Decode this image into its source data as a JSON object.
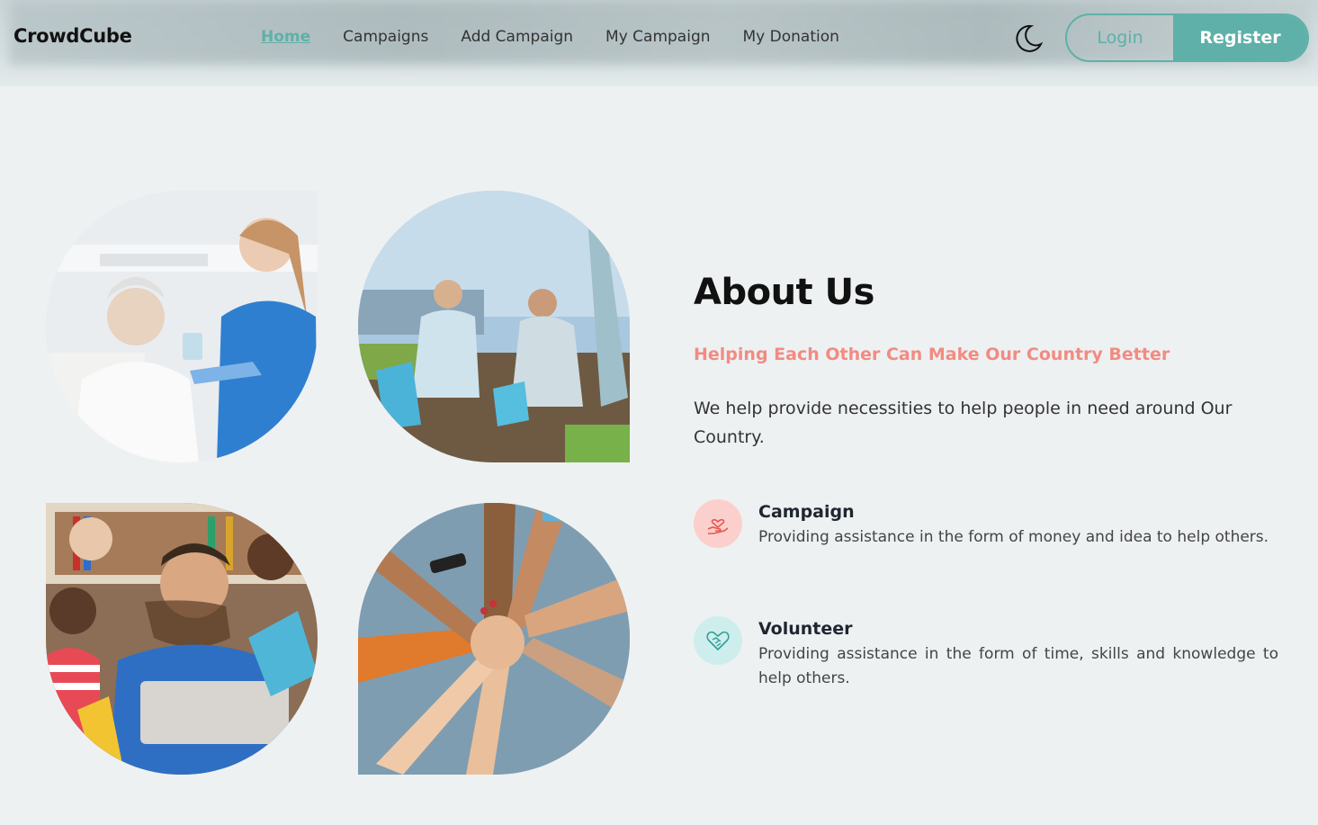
{
  "header": {
    "logo": "CrowdCube",
    "nav": [
      {
        "label": "Home",
        "active": true
      },
      {
        "label": "Campaigns",
        "active": false
      },
      {
        "label": "Add Campaign",
        "active": false
      },
      {
        "label": "My Campaign",
        "active": false
      },
      {
        "label": "My Donation",
        "active": false
      }
    ],
    "theme_icon": "moon-icon",
    "login_label": "Login",
    "register_label": "Register"
  },
  "images": [
    {
      "name": "photo-nurse-elderly",
      "icon": "photo"
    },
    {
      "name": "photo-volunteers-cleanup",
      "icon": "photo"
    },
    {
      "name": "photo-teacher-children",
      "icon": "photo"
    },
    {
      "name": "photo-hands-together",
      "icon": "photo"
    }
  ],
  "about": {
    "title": "About Us",
    "tagline": "Helping Each Other Can Make Our Country Better",
    "description": "We help provide necessities to help people in need around Our Country.",
    "features": [
      {
        "title": "Campaign",
        "text": "Providing assistance in the form of money and idea to help others.",
        "icon": "heart-hand-icon"
      },
      {
        "title": "Volunteer",
        "text": "Providing assistance in the form of time, skills and knowledge to help others.",
        "icon": "handshake-heart-icon"
      }
    ]
  },
  "colors": {
    "accent": "#5fb0a8",
    "tagline": "#f28b82",
    "background": "#eef1f2"
  }
}
